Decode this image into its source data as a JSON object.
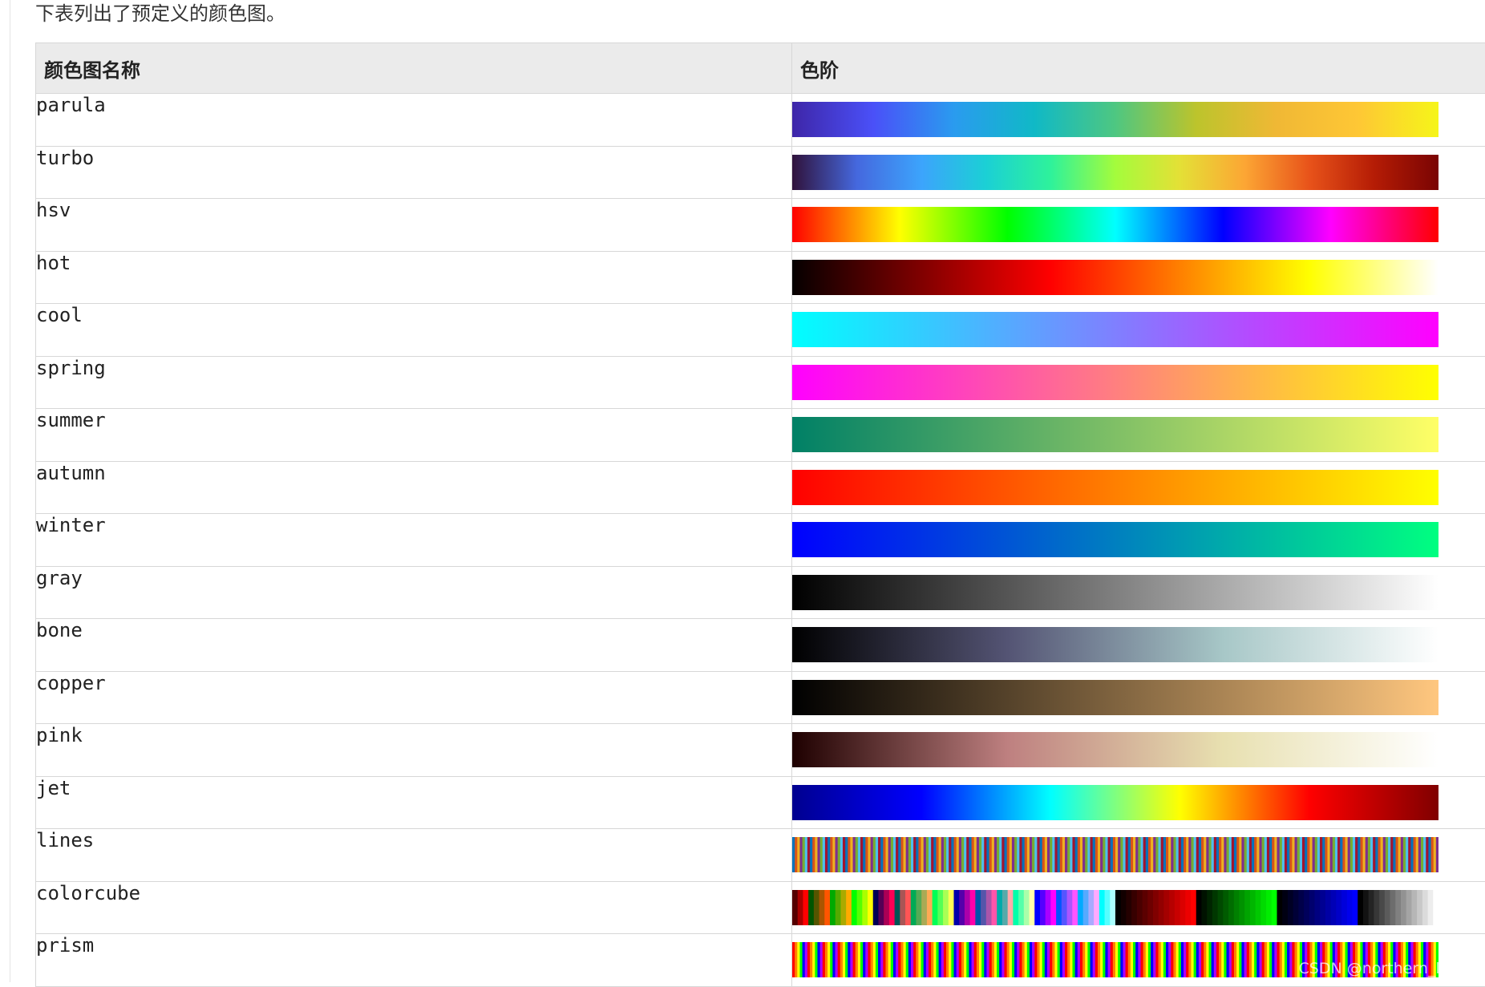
{
  "intro_text": "下表列出了预定义的颜色图。",
  "table": {
    "headers": [
      "颜色图名称",
      "色阶"
    ],
    "rows": [
      {
        "name": "parula",
        "kind": "gradient",
        "stops": [
          "#3e26a8",
          "#4a50f8",
          "#2a9bef",
          "#10b9c6",
          "#4ec781",
          "#bcc42c",
          "#f0b835",
          "#fec735",
          "#f6f519"
        ]
      },
      {
        "name": "turbo",
        "kind": "gradient",
        "stops": [
          "#30123b",
          "#4568de",
          "#3ca4fc",
          "#1bd0d5",
          "#2ef29b",
          "#a4fc3c",
          "#e4e036",
          "#fca634",
          "#e8531a",
          "#b51c05",
          "#7a0403"
        ]
      },
      {
        "name": "hsv",
        "kind": "gradient",
        "stops": [
          "#ff0000",
          "#ffff00",
          "#00ff00",
          "#00ffff",
          "#0000ff",
          "#ff00ff",
          "#ff0000"
        ]
      },
      {
        "name": "hot",
        "kind": "gradient",
        "stops": [
          "#050000",
          "#800000",
          "#ff0000",
          "#ff8000",
          "#ffff00",
          "#ffffff"
        ]
      },
      {
        "name": "cool",
        "kind": "gradient",
        "stops": [
          "#00ffff",
          "#ff00ff"
        ]
      },
      {
        "name": "spring",
        "kind": "gradient",
        "stops": [
          "#ff00ff",
          "#ffff00"
        ]
      },
      {
        "name": "summer",
        "kind": "gradient",
        "stops": [
          "#008066",
          "#ffff66"
        ]
      },
      {
        "name": "autumn",
        "kind": "gradient",
        "stops": [
          "#ff0000",
          "#ffff00"
        ]
      },
      {
        "name": "winter",
        "kind": "gradient",
        "stops": [
          "#0000ff",
          "#00ff80"
        ]
      },
      {
        "name": "gray",
        "kind": "gradient",
        "stops": [
          "#000000",
          "#ffffff"
        ]
      },
      {
        "name": "bone",
        "kind": "gradient",
        "stops": [
          "#000000",
          "#545474",
          "#a7c7c7",
          "#ffffff"
        ]
      },
      {
        "name": "copper",
        "kind": "gradient",
        "stops": [
          "#000000",
          "#ffc77f"
        ]
      },
      {
        "name": "pink",
        "kind": "gradient",
        "stops": [
          "#1e0000",
          "#be8080",
          "#e8e0b0",
          "#ffffff"
        ]
      },
      {
        "name": "jet",
        "kind": "gradient",
        "stops": [
          "#00008f",
          "#0000ff",
          "#00ffff",
          "#ffff00",
          "#ff0000",
          "#800000"
        ]
      },
      {
        "name": "lines",
        "kind": "stripes",
        "stops": [
          "#0072bd",
          "#d95319",
          "#edb120",
          "#7e2f8e",
          "#77ac30",
          "#4dbeee",
          "#a2142f"
        ]
      },
      {
        "name": "colorcube",
        "kind": "colorcube",
        "stops": []
      },
      {
        "name": "prism",
        "kind": "stripes",
        "stops": [
          "#ff0000",
          "#ff8000",
          "#ffff00",
          "#00ff00",
          "#0000ff",
          "#aa00ff"
        ]
      }
    ]
  },
  "watermark": "CSDN @northern_light_"
}
